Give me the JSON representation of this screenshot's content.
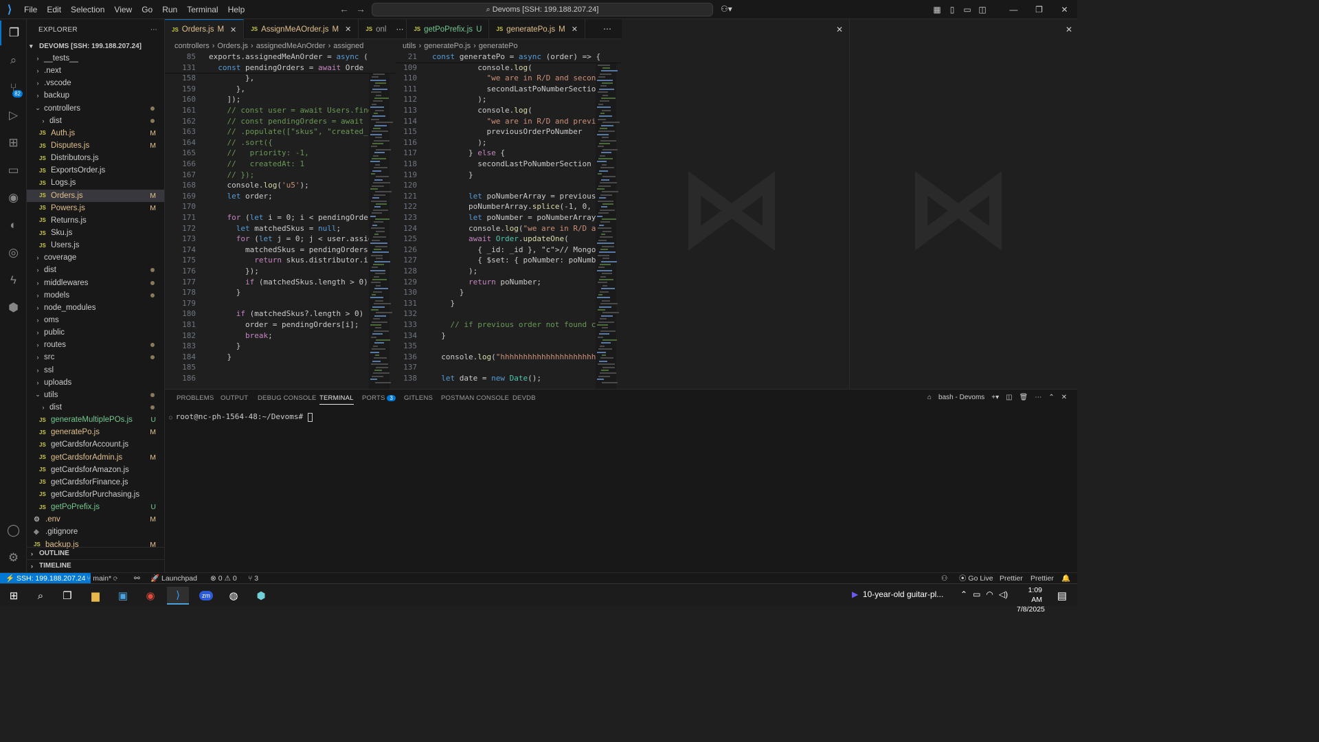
{
  "menu": [
    "File",
    "Edit",
    "Selection",
    "View",
    "Go",
    "Run",
    "Terminal",
    "Help"
  ],
  "command_center": "Devoms [SSH: 199.188.207.24]",
  "explorer": {
    "title": "EXPLORER",
    "root": "DEVOMS [SSH: 199.188.207.24]",
    "items": [
      {
        "label": "__tests__",
        "type": "folder",
        "indent": 0
      },
      {
        "label": ".next",
        "type": "folder",
        "indent": 0
      },
      {
        "label": ".vscode",
        "type": "folder",
        "indent": 0
      },
      {
        "label": "backup",
        "type": "folder",
        "indent": 0
      },
      {
        "label": "controllers",
        "type": "folder-open",
        "indent": 0,
        "dot": true
      },
      {
        "label": "dist",
        "type": "folder",
        "indent": 1,
        "dot": true
      },
      {
        "label": "Auth.js",
        "type": "js",
        "indent": 1,
        "status": "M"
      },
      {
        "label": "Disputes.js",
        "type": "js",
        "indent": 1,
        "status": "M"
      },
      {
        "label": "Distributors.js",
        "type": "js",
        "indent": 1
      },
      {
        "label": "ExportsOrder.js",
        "type": "js",
        "indent": 1
      },
      {
        "label": "Logs.js",
        "type": "js",
        "indent": 1
      },
      {
        "label": "Orders.js",
        "type": "js",
        "indent": 1,
        "status": "M",
        "selected": true
      },
      {
        "label": "Powers.js",
        "type": "js",
        "indent": 1,
        "status": "M"
      },
      {
        "label": "Returns.js",
        "type": "js",
        "indent": 1
      },
      {
        "label": "Sku.js",
        "type": "js",
        "indent": 1
      },
      {
        "label": "Users.js",
        "type": "js",
        "indent": 1
      },
      {
        "label": "coverage",
        "type": "folder",
        "indent": 0
      },
      {
        "label": "dist",
        "type": "folder",
        "indent": 0,
        "dot": true
      },
      {
        "label": "middlewares",
        "type": "folder",
        "indent": 0,
        "dot": true
      },
      {
        "label": "models",
        "type": "folder",
        "indent": 0,
        "dot": true
      },
      {
        "label": "node_modules",
        "type": "folder",
        "indent": 0
      },
      {
        "label": "oms",
        "type": "folder",
        "indent": 0
      },
      {
        "label": "public",
        "type": "folder",
        "indent": 0
      },
      {
        "label": "routes",
        "type": "folder",
        "indent": 0,
        "dot": true
      },
      {
        "label": "src",
        "type": "folder",
        "indent": 0,
        "dot": true
      },
      {
        "label": "ssl",
        "type": "folder",
        "indent": 0
      },
      {
        "label": "uploads",
        "type": "folder",
        "indent": 0
      },
      {
        "label": "utils",
        "type": "folder-open",
        "indent": 0,
        "dot": true
      },
      {
        "label": "dist",
        "type": "folder",
        "indent": 1,
        "dot": true
      },
      {
        "label": "generateMultiplePOs.js",
        "type": "js",
        "indent": 1,
        "status": "U"
      },
      {
        "label": "generatePo.js",
        "type": "js",
        "indent": 1,
        "status": "M"
      },
      {
        "label": "getCardsforAccount.js",
        "type": "js",
        "indent": 1
      },
      {
        "label": "getCardsforAdmin.js",
        "type": "js",
        "indent": 1,
        "status": "M"
      },
      {
        "label": "getCardsforAmazon.js",
        "type": "js",
        "indent": 1
      },
      {
        "label": "getCardsforFinance.js",
        "type": "js",
        "indent": 1
      },
      {
        "label": "getCardsforPurchasing.js",
        "type": "js",
        "indent": 1
      },
      {
        "label": "getPoPrefix.js",
        "type": "js",
        "indent": 1,
        "status": "U"
      },
      {
        "label": ".env",
        "type": "gear",
        "indent": 0,
        "status": "M"
      },
      {
        "label": ".gitignore",
        "type": "plain",
        "indent": 0
      },
      {
        "label": "backup.js",
        "type": "js",
        "indent": 0,
        "status": "M"
      }
    ],
    "outline": "OUTLINE",
    "timeline": "TIMELINE"
  },
  "tabs": [
    {
      "label": "Orders.js",
      "status": "M",
      "active": true
    },
    {
      "label": "AssignMeAOrder.js",
      "status": "M"
    },
    {
      "label": "onl",
      "status": ""
    },
    {
      "label": "getPoPrefix.js",
      "status": "U"
    },
    {
      "label": "generatePo.js",
      "status": "M"
    }
  ],
  "left_breadcrumb": [
    "controllers",
    "Orders.js",
    "assignedMeAnOrder",
    "assigned"
  ],
  "right_breadcrumb": [
    "utils",
    "generatePo.js",
    "generatePo"
  ],
  "left_sticky": [
    {
      "n": "85",
      "t": "exports.assignedMeAnOrder = async ("
    },
    {
      "n": "131",
      "t": "  const pendingOrders = await Orde"
    }
  ],
  "left_lines": [
    {
      "n": "158",
      "t": "        },"
    },
    {
      "n": "159",
      "t": "      },"
    },
    {
      "n": "160",
      "t": "    ]);"
    },
    {
      "n": "161",
      "t": "    // const user = await Users.find"
    },
    {
      "n": "162",
      "t": "    // const pendingOrders = await ("
    },
    {
      "n": "163",
      "t": "    // .populate([\"skus\", \"created_"
    },
    {
      "n": "164",
      "t": "    // .sort({"
    },
    {
      "n": "165",
      "t": "    //   priority: -1,"
    },
    {
      "n": "166",
      "t": "    //   createdAt: 1"
    },
    {
      "n": "167",
      "t": "    // });"
    },
    {
      "n": "168",
      "t": "    console.log('u5');"
    },
    {
      "n": "169",
      "t": "    let order;"
    },
    {
      "n": "170",
      "t": ""
    },
    {
      "n": "171",
      "t": "    for (let i = 0; i < pendingOrde"
    },
    {
      "n": "172",
      "t": "      let matchedSkus = null;"
    },
    {
      "n": "173",
      "t": "      for (let j = 0; j < user.assig"
    },
    {
      "n": "174",
      "t": "        matchedSkus = pendingOrders"
    },
    {
      "n": "175",
      "t": "          return skus.distributor.i"
    },
    {
      "n": "176",
      "t": "        });"
    },
    {
      "n": "177",
      "t": "        if (matchedSkus.length > 0)"
    },
    {
      "n": "178",
      "t": "      }"
    },
    {
      "n": "179",
      "t": ""
    },
    {
      "n": "180",
      "t": "      if (matchedSkus?.length > 0) {"
    },
    {
      "n": "181",
      "t": "        order = pendingOrders[i];"
    },
    {
      "n": "182",
      "t": "        break;"
    },
    {
      "n": "183",
      "t": "      }"
    },
    {
      "n": "184",
      "t": "    }"
    },
    {
      "n": "185",
      "t": ""
    },
    {
      "n": "186",
      "t": ""
    }
  ],
  "right_sticky": {
    "n": "21",
    "t": "const generatePo = async (order) => {"
  },
  "right_lines": [
    {
      "n": "109",
      "t": "          console.log("
    },
    {
      "n": "110",
      "t": "            \"we are in R/D and secon"
    },
    {
      "n": "111",
      "t": "            secondLastPoNumberSectio"
    },
    {
      "n": "112",
      "t": "          );"
    },
    {
      "n": "113",
      "t": "          console.log("
    },
    {
      "n": "114",
      "t": "            \"we are in R/D and previ"
    },
    {
      "n": "115",
      "t": "            previousOrderPoNumber"
    },
    {
      "n": "116",
      "t": "          );"
    },
    {
      "n": "117",
      "t": "        } else {"
    },
    {
      "n": "118",
      "t": "          secondLastPoNumberSection"
    },
    {
      "n": "119",
      "t": "        }"
    },
    {
      "n": "120",
      "t": ""
    },
    {
      "n": "121",
      "t": "        let poNumberArray = previous"
    },
    {
      "n": "122",
      "t": "        poNumberArray.splice(-1, 0,"
    },
    {
      "n": "123",
      "t": "        let poNumber = poNumberArray"
    },
    {
      "n": "124",
      "t": "        console.log(\"we are in R/D a"
    },
    {
      "n": "125",
      "t": "        await Order.updateOne("
    },
    {
      "n": "126",
      "t": "          { _id: _id }, // Mongoose"
    },
    {
      "n": "127",
      "t": "          { $set: { poNumber: poNumb"
    },
    {
      "n": "128",
      "t": "        );"
    },
    {
      "n": "129",
      "t": "        return poNumber;"
    },
    {
      "n": "130",
      "t": "      }"
    },
    {
      "n": "131",
      "t": "    }"
    },
    {
      "n": "132",
      "t": ""
    },
    {
      "n": "133",
      "t": "    // if previous order not found c"
    },
    {
      "n": "134",
      "t": "  }"
    },
    {
      "n": "135",
      "t": ""
    },
    {
      "n": "136",
      "t": "  console.log(\"hhhhhhhhhhhhhhhhhhhhh"
    },
    {
      "n": "137",
      "t": ""
    },
    {
      "n": "138",
      "t": "  let date = new Date();"
    }
  ],
  "panel": {
    "tabs": [
      "PROBLEMS",
      "OUTPUT",
      "DEBUG CONSOLE",
      "TERMINAL",
      "PORTS",
      "GITLENS",
      "POSTMAN CONSOLE",
      "DEVDB"
    ],
    "ports_badge": "3",
    "terminal_name": "bash - Devoms",
    "prompt": "root@nc-ph-1564-48:~/Devoms# "
  },
  "status": {
    "remote": "SSH: 199.188.207.24",
    "branch": "main*",
    "launchpad": "Launchpad",
    "errors": "0",
    "warnings": "0",
    "ports": "3",
    "golive": "Go Live",
    "prettier1": "Prettier",
    "prettier2": "Prettier"
  },
  "taskbar": {
    "media": "10-year-old guitar-pl...",
    "time": "1:09 AM",
    "date": "7/8/2025"
  }
}
